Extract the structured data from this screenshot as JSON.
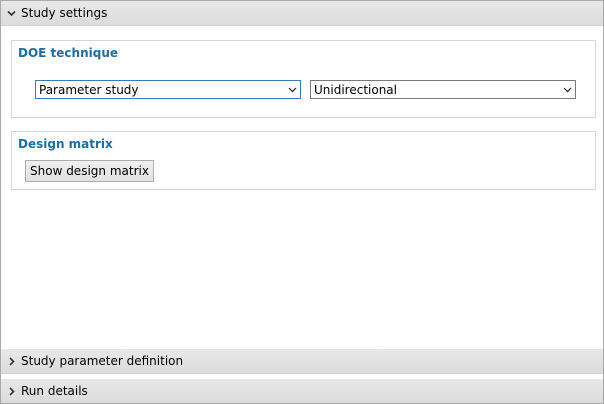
{
  "sections": {
    "study_settings": "Study settings",
    "study_parameter_definition": "Study parameter definition",
    "run_details": "Run details"
  },
  "doe": {
    "title": "DOE technique",
    "technique_value": "Parameter study",
    "direction_value": "Unidirectional"
  },
  "design_matrix": {
    "title": "Design matrix",
    "show_button": "Show design matrix"
  },
  "colors": {
    "accent": "#1f6ea2",
    "header_bg": "#dcdcdc"
  }
}
